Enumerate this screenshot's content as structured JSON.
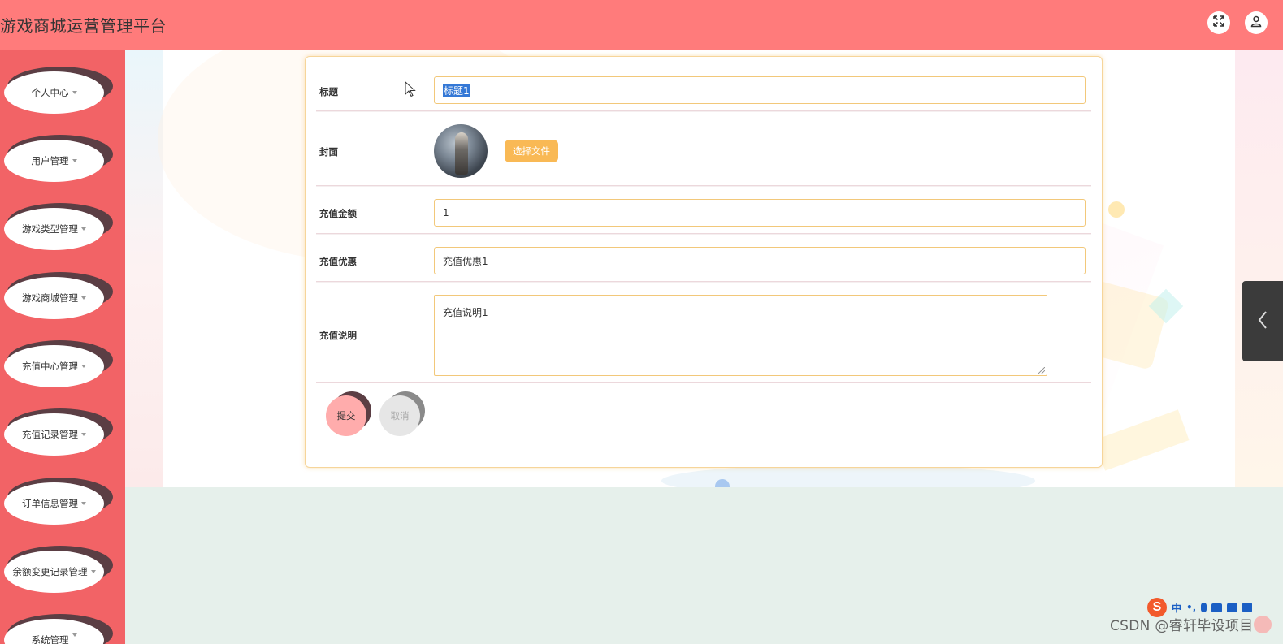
{
  "app": {
    "title": "游戏商城运营管理平台"
  },
  "header": {
    "fullscreen_icon": "expand-arrows-icon",
    "user_icon": "user-icon"
  },
  "sidebar": {
    "items": [
      {
        "label": "个人中心"
      },
      {
        "label": "用户管理"
      },
      {
        "label": "游戏类型管理"
      },
      {
        "label": "游戏商城管理"
      },
      {
        "label": "充值中心管理"
      },
      {
        "label": "充值记录管理"
      },
      {
        "label": "订单信息管理"
      },
      {
        "label": "余额变更记录管理"
      },
      {
        "label": "系统管理"
      }
    ]
  },
  "form": {
    "title_label": "标题",
    "title_value": "标题1",
    "cover_label": "封面",
    "file_button": "选择文件",
    "amount_label": "充值金额",
    "amount_value": "1",
    "discount_label": "充值优惠",
    "discount_value": "充值优惠1",
    "desc_label": "充值说明",
    "desc_value": "充值说明1",
    "submit_label": "提交",
    "cancel_label": "取消"
  },
  "colors": {
    "header_bg": "#ff7b7b",
    "sidebar_bg": "#f26366",
    "accent_orange": "#f9b955",
    "submit_bg": "#ffacac",
    "cancel_bg": "#e6e6e6"
  },
  "ime": {
    "lang": "中"
  },
  "watermark": {
    "text": "CSDN @睿轩毕设项目"
  }
}
